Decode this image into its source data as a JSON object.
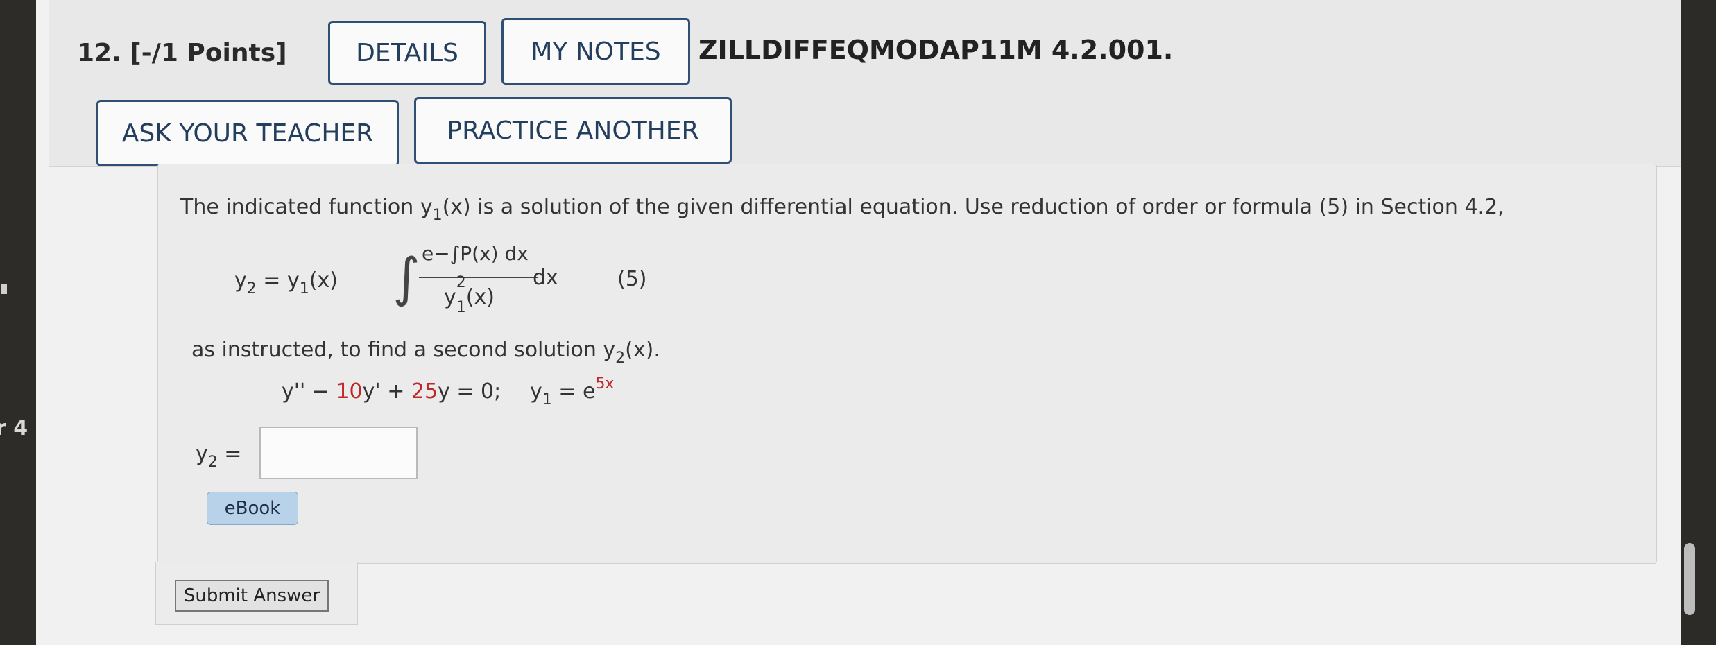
{
  "question": {
    "title": "12. [-/1 Points]",
    "details_label": "DETAILS",
    "my_notes_label": "MY NOTES",
    "code": "ZILLDIFFEQMODAP11M 4.2.001.",
    "ask_teacher_label": "ASK YOUR TEACHER",
    "practice_label": "PRACTICE ANOTHER"
  },
  "problem": {
    "intro_a": "The indicated function ",
    "intro_y": "y",
    "intro_sub": "1",
    "intro_b": "(x) is a solution of the given differential equation. Use reduction of order or formula (5) in Section 4.2,",
    "formula_lhs": "y",
    "formula_lhs_sub": "2",
    "formula_eq": " = y",
    "formula_y1_sub": "1",
    "formula_y1_arg": "(x)",
    "formula_numer": "e−∫P(x) dx",
    "formula_denom_y": "y",
    "formula_denom_sup": "2",
    "formula_denom_sub": "1",
    "formula_denom_arg": "(x)",
    "formula_dx": "dx",
    "formula_number": "(5)",
    "instruction_a": "as instructed, to find a second solution ",
    "instruction_y": "y",
    "instruction_sub": "2",
    "instruction_b": "(x).",
    "eq_y2": "y'' − ",
    "eq_coef1": "10",
    "eq_y1": "y' + ",
    "eq_coef2": "25",
    "eq_y0": "y = 0;",
    "eq_given_y": "y",
    "eq_given_sub": "1",
    "eq_given_eq": " = e",
    "eq_given_sup": "5x",
    "answer_label_y": "y",
    "answer_label_sub": "2",
    "answer_label_eq": " =",
    "answer_value": "",
    "ebook_label": "eBook",
    "submit_label": "Submit Answer"
  },
  "edge_text": "r 4"
}
